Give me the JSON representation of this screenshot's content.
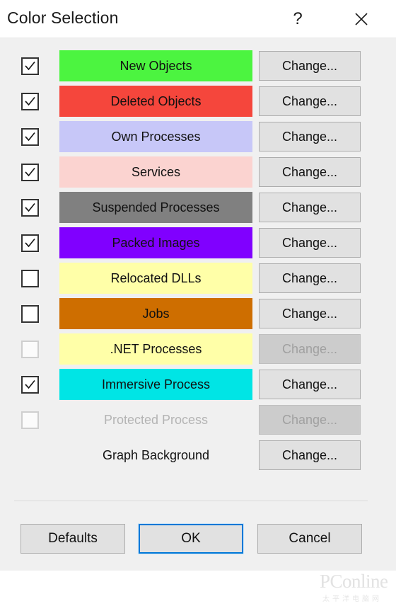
{
  "window": {
    "title": "Color Selection",
    "help_icon": "question-mark-icon",
    "help_label": "?",
    "close_icon": "close-icon"
  },
  "rows": [
    {
      "label": "New Objects",
      "color": "#4CF440",
      "checkbox": "checked",
      "button_label": "Change...",
      "button_enabled": true,
      "has_swatch": true
    },
    {
      "label": "Deleted Objects",
      "color": "#F5463C",
      "checkbox": "checked",
      "button_label": "Change...",
      "button_enabled": true,
      "has_swatch": true
    },
    {
      "label": "Own Processes",
      "color": "#C7C7F8",
      "checkbox": "checked",
      "button_label": "Change...",
      "button_enabled": true,
      "has_swatch": true
    },
    {
      "label": "Services",
      "color": "#FBD3D0",
      "checkbox": "checked",
      "button_label": "Change...",
      "button_enabled": true,
      "has_swatch": true
    },
    {
      "label": "Suspended Processes",
      "color": "#808080",
      "checkbox": "checked",
      "button_label": "Change...",
      "button_enabled": true,
      "has_swatch": true
    },
    {
      "label": "Packed Images",
      "color": "#8000FF",
      "checkbox": "checked",
      "button_label": "Change...",
      "button_enabled": true,
      "has_swatch": true
    },
    {
      "label": "Relocated DLLs",
      "color": "#FFFFA8",
      "checkbox": "unchecked",
      "button_label": "Change...",
      "button_enabled": true,
      "has_swatch": true
    },
    {
      "label": "Jobs",
      "color": "#CE6E00",
      "checkbox": "unchecked",
      "button_label": "Change...",
      "button_enabled": true,
      "has_swatch": true
    },
    {
      "label": ".NET Processes",
      "color": "#FFFFA8",
      "checkbox": "disabled",
      "button_label": "Change...",
      "button_enabled": false,
      "has_swatch": true
    },
    {
      "label": "Immersive Process",
      "color": "#00E5E5",
      "checkbox": "checked",
      "button_label": "Change...",
      "button_enabled": true,
      "has_swatch": true
    },
    {
      "label": "Protected Process",
      "color": "",
      "checkbox": "disabled",
      "button_label": "Change...",
      "button_enabled": false,
      "has_swatch": false,
      "label_dim": true
    },
    {
      "label": "Graph Background",
      "color": "",
      "checkbox": "none",
      "button_label": "Change...",
      "button_enabled": true,
      "has_swatch": false
    }
  ],
  "footer": {
    "defaults_label": "Defaults",
    "ok_label": "OK",
    "cancel_label": "Cancel"
  },
  "watermark": {
    "text": "PConline",
    "subtext": "太平洋电脑网"
  },
  "colors": {
    "dialog_background": "#F0F0F0",
    "titlebar_background": "#FFFFFF",
    "button_face": "#E1E1E1",
    "button_disabled": "#CCCCCC",
    "focus_accent": "#0078D7"
  }
}
